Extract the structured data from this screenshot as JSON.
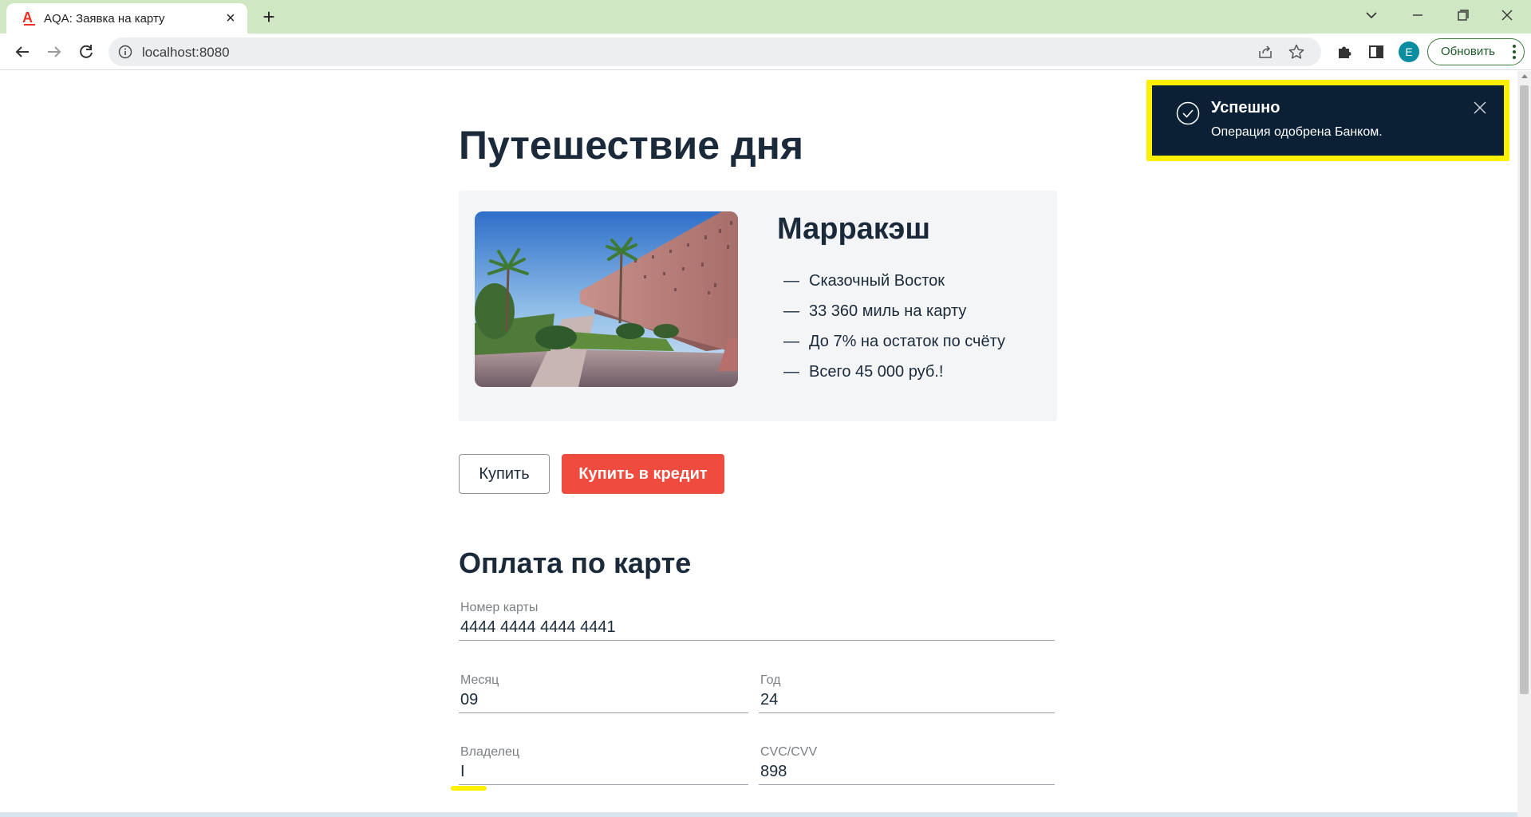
{
  "browser": {
    "tab_title": "AQA: Заявка на карту",
    "url": "localhost:8080",
    "avatar_letter": "E",
    "update_label": "Обновить",
    "accent_color": "#cfe8c3"
  },
  "page": {
    "title": "Путешествие дня",
    "offer": {
      "city": "Марракэш",
      "features": [
        "Сказочный Восток",
        "33 360 миль на карту",
        "До 7% на остаток по счёту",
        "Всего 45 000 руб.!"
      ],
      "dash": "—"
    },
    "buttons": {
      "buy": "Купить",
      "buy_credit": "Купить в кредит",
      "credit_color": "#ef4b3e"
    },
    "payment": {
      "title": "Оплата по карте",
      "card_number": {
        "label": "Номер карты",
        "value": "4444 4444 4444 4441"
      },
      "month": {
        "label": "Месяц",
        "value": "09"
      },
      "year": {
        "label": "Год",
        "value": "24"
      },
      "owner": {
        "label": "Владелец",
        "value": "I"
      },
      "cvc": {
        "label": "CVC/CVV",
        "value": "898"
      }
    }
  },
  "notification": {
    "title": "Успешно",
    "message": "Операция одобрена Банком.",
    "background": "#0b1f35",
    "highlight_color": "#ffef00"
  }
}
